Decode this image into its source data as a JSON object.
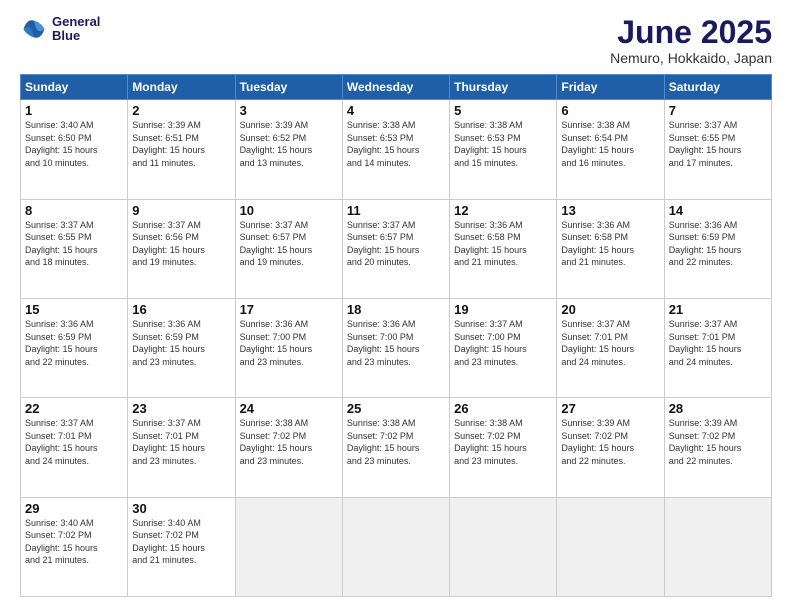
{
  "header": {
    "logo_line1": "General",
    "logo_line2": "Blue",
    "month_title": "June 2025",
    "location": "Nemuro, Hokkaido, Japan"
  },
  "days_of_week": [
    "Sunday",
    "Monday",
    "Tuesday",
    "Wednesday",
    "Thursday",
    "Friday",
    "Saturday"
  ],
  "weeks": [
    [
      {
        "day": 1,
        "info": "Sunrise: 3:40 AM\nSunset: 6:50 PM\nDaylight: 15 hours\nand 10 minutes."
      },
      {
        "day": 2,
        "info": "Sunrise: 3:39 AM\nSunset: 6:51 PM\nDaylight: 15 hours\nand 11 minutes."
      },
      {
        "day": 3,
        "info": "Sunrise: 3:39 AM\nSunset: 6:52 PM\nDaylight: 15 hours\nand 13 minutes."
      },
      {
        "day": 4,
        "info": "Sunrise: 3:38 AM\nSunset: 6:53 PM\nDaylight: 15 hours\nand 14 minutes."
      },
      {
        "day": 5,
        "info": "Sunrise: 3:38 AM\nSunset: 6:53 PM\nDaylight: 15 hours\nand 15 minutes."
      },
      {
        "day": 6,
        "info": "Sunrise: 3:38 AM\nSunset: 6:54 PM\nDaylight: 15 hours\nand 16 minutes."
      },
      {
        "day": 7,
        "info": "Sunrise: 3:37 AM\nSunset: 6:55 PM\nDaylight: 15 hours\nand 17 minutes."
      }
    ],
    [
      {
        "day": 8,
        "info": "Sunrise: 3:37 AM\nSunset: 6:55 PM\nDaylight: 15 hours\nand 18 minutes."
      },
      {
        "day": 9,
        "info": "Sunrise: 3:37 AM\nSunset: 6:56 PM\nDaylight: 15 hours\nand 19 minutes."
      },
      {
        "day": 10,
        "info": "Sunrise: 3:37 AM\nSunset: 6:57 PM\nDaylight: 15 hours\nand 19 minutes."
      },
      {
        "day": 11,
        "info": "Sunrise: 3:37 AM\nSunset: 6:57 PM\nDaylight: 15 hours\nand 20 minutes."
      },
      {
        "day": 12,
        "info": "Sunrise: 3:36 AM\nSunset: 6:58 PM\nDaylight: 15 hours\nand 21 minutes."
      },
      {
        "day": 13,
        "info": "Sunrise: 3:36 AM\nSunset: 6:58 PM\nDaylight: 15 hours\nand 21 minutes."
      },
      {
        "day": 14,
        "info": "Sunrise: 3:36 AM\nSunset: 6:59 PM\nDaylight: 15 hours\nand 22 minutes."
      }
    ],
    [
      {
        "day": 15,
        "info": "Sunrise: 3:36 AM\nSunset: 6:59 PM\nDaylight: 15 hours\nand 22 minutes."
      },
      {
        "day": 16,
        "info": "Sunrise: 3:36 AM\nSunset: 6:59 PM\nDaylight: 15 hours\nand 23 minutes."
      },
      {
        "day": 17,
        "info": "Sunrise: 3:36 AM\nSunset: 7:00 PM\nDaylight: 15 hours\nand 23 minutes."
      },
      {
        "day": 18,
        "info": "Sunrise: 3:36 AM\nSunset: 7:00 PM\nDaylight: 15 hours\nand 23 minutes."
      },
      {
        "day": 19,
        "info": "Sunrise: 3:37 AM\nSunset: 7:00 PM\nDaylight: 15 hours\nand 23 minutes."
      },
      {
        "day": 20,
        "info": "Sunrise: 3:37 AM\nSunset: 7:01 PM\nDaylight: 15 hours\nand 24 minutes."
      },
      {
        "day": 21,
        "info": "Sunrise: 3:37 AM\nSunset: 7:01 PM\nDaylight: 15 hours\nand 24 minutes."
      }
    ],
    [
      {
        "day": 22,
        "info": "Sunrise: 3:37 AM\nSunset: 7:01 PM\nDaylight: 15 hours\nand 24 minutes."
      },
      {
        "day": 23,
        "info": "Sunrise: 3:37 AM\nSunset: 7:01 PM\nDaylight: 15 hours\nand 23 minutes."
      },
      {
        "day": 24,
        "info": "Sunrise: 3:38 AM\nSunset: 7:02 PM\nDaylight: 15 hours\nand 23 minutes."
      },
      {
        "day": 25,
        "info": "Sunrise: 3:38 AM\nSunset: 7:02 PM\nDaylight: 15 hours\nand 23 minutes."
      },
      {
        "day": 26,
        "info": "Sunrise: 3:38 AM\nSunset: 7:02 PM\nDaylight: 15 hours\nand 23 minutes."
      },
      {
        "day": 27,
        "info": "Sunrise: 3:39 AM\nSunset: 7:02 PM\nDaylight: 15 hours\nand 22 minutes."
      },
      {
        "day": 28,
        "info": "Sunrise: 3:39 AM\nSunset: 7:02 PM\nDaylight: 15 hours\nand 22 minutes."
      }
    ],
    [
      {
        "day": 29,
        "info": "Sunrise: 3:40 AM\nSunset: 7:02 PM\nDaylight: 15 hours\nand 21 minutes."
      },
      {
        "day": 30,
        "info": "Sunrise: 3:40 AM\nSunset: 7:02 PM\nDaylight: 15 hours\nand 21 minutes."
      },
      null,
      null,
      null,
      null,
      null
    ]
  ]
}
